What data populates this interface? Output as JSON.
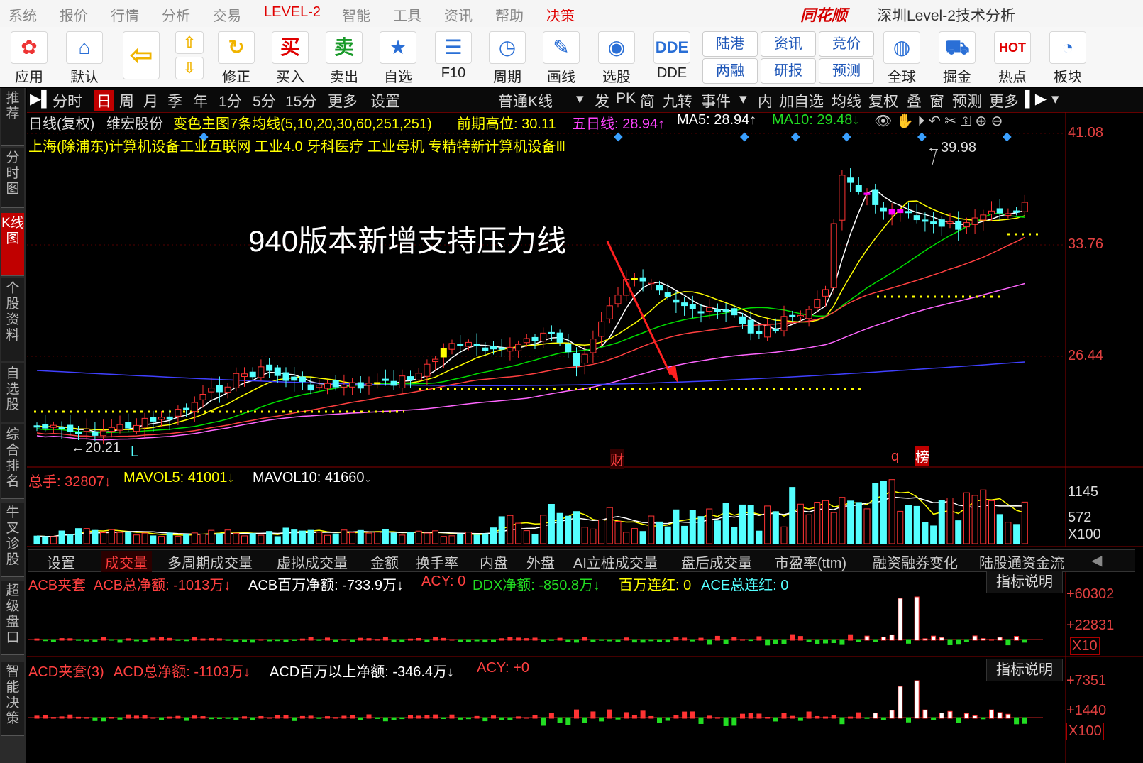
{
  "menu": [
    "系统",
    "报价",
    "行情",
    "分析",
    "交易",
    "LEVEL-2",
    "智能",
    "工具",
    "资讯",
    "帮助",
    "决策"
  ],
  "brand": "同花顺",
  "window_title": "深圳Level-2技术分析",
  "toolbar": [
    "应用",
    "默认",
    "修正",
    "买入",
    "卖出",
    "自选",
    "F10",
    "周期",
    "画线",
    "选股",
    "DDE",
    "全球",
    "掘金",
    "热点",
    "板块"
  ],
  "toolbar_small": [
    "陆港",
    "两融",
    "资讯",
    "研报",
    "竞价",
    "预测"
  ],
  "toolbar_icons": {
    "buy": "买",
    "sell": "卖",
    "dde": "DDE"
  },
  "sidebar": [
    "推荐",
    "分时图",
    "K线图",
    "个股资料",
    "自选股",
    "综合排名",
    "牛叉诊股",
    "超级盘口",
    "智能决策"
  ],
  "periods": [
    "分时",
    "日",
    "周",
    "月",
    "季",
    "年",
    "1分",
    "5分",
    "15分",
    "更多",
    "设置"
  ],
  "chart_type": "普通K线",
  "right_tools": [
    "发",
    "PK",
    "简",
    "九转",
    "事件",
    "内",
    "加自选",
    "均线",
    "复权",
    "叠",
    "窗",
    "预测",
    "更多"
  ],
  "header": {
    "line1_prefix": "日线(复权)",
    "stock": "维宏股份",
    "ma_title": "变色主图7条均线(5,10,20,30,60,251,251)",
    "prev_high": "前期高位: 30.11",
    "ma5_line": "五日线: 28.94↑",
    "ma5": "MA5: 28.94↑",
    "ma10": "MA10: 29.48↓",
    "concepts": "上海(除浦东)计算机设备工业互联网 工业4.0 牙科医疗 工业母机 专精特新计算机设备Ⅲ"
  },
  "annotation": "940版本新增支持压力线",
  "price_labels": {
    "high": "←39.98",
    "low": "←20.21",
    "low_mark": "L"
  },
  "y_axis": [
    "41.08",
    "33.76",
    "26.44"
  ],
  "event_marks": [
    "财",
    "q",
    "榜"
  ],
  "volume": {
    "total": "总手: 32807↓",
    "mavol5": "MAVOL5: 41001↓",
    "mavol10": "MAVOL10: 41660↓",
    "y_axis": [
      "1145",
      "572",
      "X100"
    ]
  },
  "tabs": [
    "设置",
    "成交量",
    "多周期成交量",
    "虚拟成交量",
    "金额",
    "换手率",
    "内盘",
    "外盘",
    "AI立桩成交量",
    "盘后成交量",
    "市盈率(ttm)",
    "融资融券变化",
    "陆股通资金流"
  ],
  "acb": {
    "title": "ACB夹套",
    "total": "ACB总净额: -1013万↓",
    "million": "ACB百万净额: -733.9万↓",
    "acy": "ACY: 0",
    "ddx": "DDX净额: -850.8万↓",
    "red": "百万连红: 0",
    "ace": "ACE总连红: 0",
    "y_axis": [
      "+60302",
      "+22831",
      "X10"
    ],
    "button": "指标说明"
  },
  "acd": {
    "title": "ACD夹套(3)",
    "total": "ACD总净额: -1103万↓",
    "million": "ACD百万以上净额: -346.4万↓",
    "acy": "ACY: +0",
    "y_axis": [
      "+7351",
      "+1440",
      "X100"
    ],
    "button": "指标说明"
  },
  "colors": {
    "up": "#ff3333",
    "down": "#54ffff",
    "ma5": "#ffffff",
    "ma10": "#ffff00",
    "ma20": "#00dd00",
    "ma30": "#ff4040",
    "ma60": "#ff66ff",
    "ma251": "#4040ff",
    "support": "#ffff00"
  }
}
